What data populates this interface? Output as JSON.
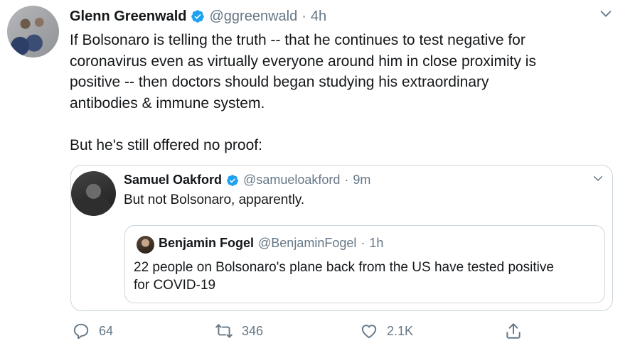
{
  "tweet": {
    "name": "Glenn Greenwald",
    "handle": "@ggreenwald",
    "separator": "·",
    "time": "4h",
    "text": "If Bolsonaro is telling the truth -- that he continues to test negative for\ncoronavirus even as virtually everyone around him in close proximity is\npositive -- then doctors should began studying his extraordinary\nantibodies & immune system.\n\nBut he's still offered no proof:",
    "verified": true
  },
  "quote": {
    "name": "Samuel Oakford",
    "handle": "@samueloakford",
    "separator": "·",
    "time": "9m",
    "text": "But not Bolsonaro, apparently.",
    "verified": true,
    "nested": {
      "name": "Benjamin Fogel",
      "handle": "@BenjaminFogel",
      "separator": "·",
      "time": "1h",
      "text": "22 people on Bolsonaro's plane back from the US have tested positive\nfor COVID-19"
    }
  },
  "actions": {
    "reply_count": "64",
    "retweet_count": "346",
    "like_count": "2.1K"
  },
  "icons": {
    "verified": "verified-badge-icon",
    "menu": "chevron-down-icon",
    "reply": "reply-icon",
    "retweet": "retweet-icon",
    "like": "heart-icon",
    "share": "share-icon"
  },
  "colors": {
    "verified": "#1da1f2",
    "secondary_text": "#657786",
    "border": "#ccd6dd"
  }
}
